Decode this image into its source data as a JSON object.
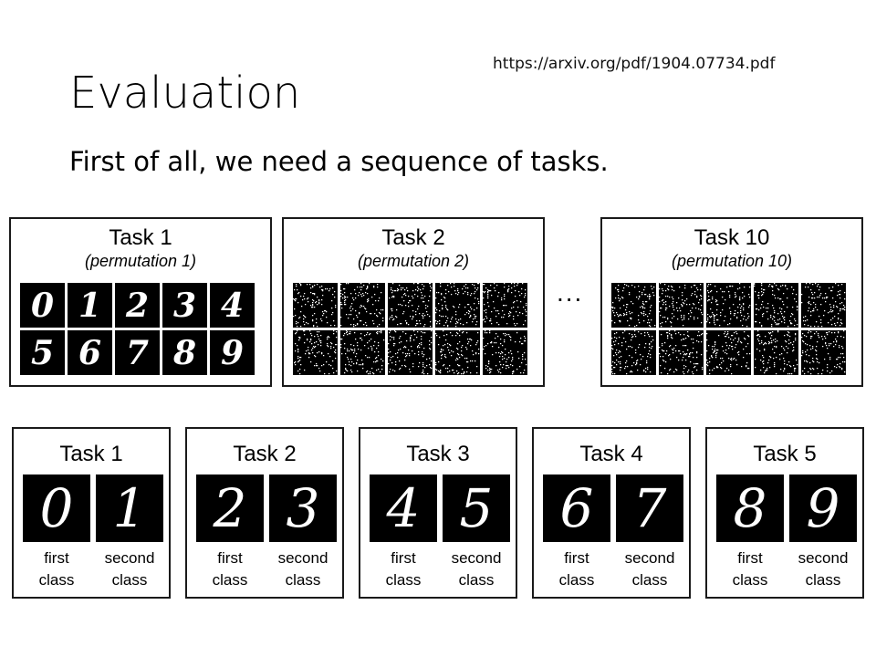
{
  "url": "https://arxiv.org/pdf/1904.07734.pdf",
  "title": "Evaluation",
  "subtitle": "First of all, we need a sequence of tasks.",
  "permuted": [
    {
      "title": "Task 1",
      "perm": "(permutation 1)",
      "digits": [
        "0",
        "1",
        "2",
        "3",
        "4",
        "5",
        "6",
        "7",
        "8",
        "9"
      ]
    },
    {
      "title": "Task 2",
      "perm": "(permutation 2)"
    },
    {
      "title": "Task 10",
      "perm": "(permutation 10)"
    }
  ],
  "ellipsis": "...",
  "split": [
    {
      "title": "Task 1",
      "digits": [
        "0",
        "1"
      ],
      "first": "first\nclass",
      "second": "second\nclass"
    },
    {
      "title": "Task 2",
      "digits": [
        "2",
        "3"
      ],
      "first": "first\nclass",
      "second": "second\nclass"
    },
    {
      "title": "Task 3",
      "digits": [
        "4",
        "5"
      ],
      "first": "first\nclass",
      "second": "second\nclass"
    },
    {
      "title": "Task 4",
      "digits": [
        "6",
        "7"
      ],
      "first": "first\nclass",
      "second": "second\nclass"
    },
    {
      "title": "Task 5",
      "digits": [
        "8",
        "9"
      ],
      "first": "first\nclass",
      "second": "second\nclass"
    }
  ]
}
